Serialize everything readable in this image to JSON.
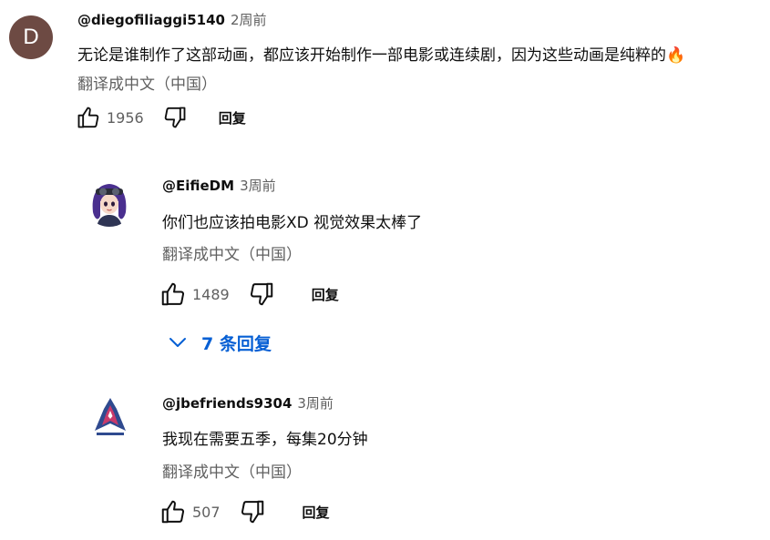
{
  "comments": [
    {
      "author": "@diegofiliaggi5140",
      "time": "2周前",
      "avatar_letter": "D",
      "avatar_color": "#6d4a43",
      "text": "无论是谁制作了这部动画，都应该开始制作一部电影或连续剧，因为这些动画是纯粹的🔥",
      "translate": "翻译成中文（中国）",
      "likes": "1956",
      "reply": "回复"
    },
    {
      "author": "@EifieDM",
      "time": "3周前",
      "text": "你们也应该拍电影XD 视觉效果太棒了",
      "translate": "翻译成中文（中国）",
      "likes": "1489",
      "reply": "回复",
      "replies_toggle": "7 条回复"
    },
    {
      "author": "@jbefriends9304",
      "time": "3周前",
      "text": "我现在需要五季，每集20分钟",
      "translate": "翻译成中文（中国）",
      "likes": "507",
      "reply": "回复"
    }
  ],
  "icons": {
    "like": "thumb-up-outline",
    "dislike": "thumb-down-outline",
    "expand": "chevron-down"
  },
  "colors": {
    "link_blue": "#065fd4",
    "secondary_text": "#606060",
    "primary_text": "#0f0f0f"
  }
}
